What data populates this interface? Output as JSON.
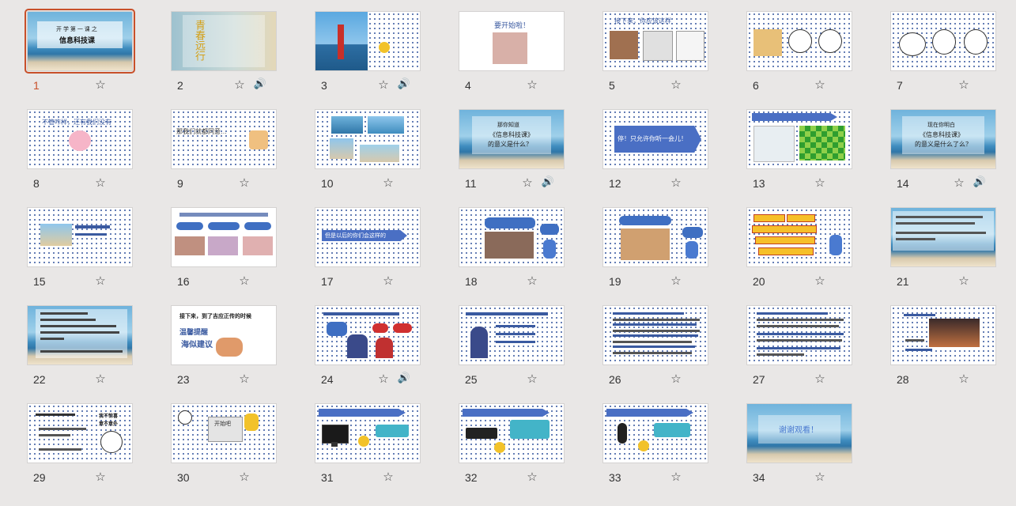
{
  "slides": [
    {
      "n": "1",
      "audio": false,
      "title_line1": "开 学 第 一 课 之",
      "title_line2": "信息科技课"
    },
    {
      "n": "2",
      "audio": true,
      "title": "青春远行"
    },
    {
      "n": "3",
      "audio": true
    },
    {
      "n": "4",
      "audio": false,
      "title": "要开始啦！"
    },
    {
      "n": "5",
      "audio": false,
      "title": "接下来，你应该这样"
    },
    {
      "n": "6",
      "audio": false
    },
    {
      "n": "7",
      "audio": false
    },
    {
      "n": "8",
      "audio": false,
      "title": "不管咋样，还有我们没有"
    },
    {
      "n": "9",
      "audio": false,
      "title": "那我们就都同意…"
    },
    {
      "n": "10",
      "audio": false
    },
    {
      "n": "11",
      "audio": true,
      "line1": "那你知道",
      "line2": "《信息科技课》",
      "line3": "的意义是什么？"
    },
    {
      "n": "12",
      "audio": false,
      "title": "停！只允许你听一会儿！"
    },
    {
      "n": "13",
      "audio": false
    },
    {
      "n": "14",
      "audio": true,
      "line1": "现在你明白",
      "line2": "《信息科技课》",
      "line3": "的意义是什么了么？"
    },
    {
      "n": "15",
      "audio": false
    },
    {
      "n": "16",
      "audio": false
    },
    {
      "n": "17",
      "audio": false,
      "title": "但是以后的你们会这样的"
    },
    {
      "n": "18",
      "audio": false
    },
    {
      "n": "19",
      "audio": false
    },
    {
      "n": "20",
      "audio": false
    },
    {
      "n": "21",
      "audio": false
    },
    {
      "n": "22",
      "audio": false
    },
    {
      "n": "23",
      "audio": false,
      "line1": "接下来，到了吉应正传的时候",
      "line2": "温馨提醒",
      "line3": "海似建议"
    },
    {
      "n": "24",
      "audio": true
    },
    {
      "n": "25",
      "audio": false
    },
    {
      "n": "26",
      "audio": false
    },
    {
      "n": "27",
      "audio": false
    },
    {
      "n": "28",
      "audio": false
    },
    {
      "n": "29",
      "audio": false,
      "side": "我不惊喜",
      "side2": "意不意外"
    },
    {
      "n": "30",
      "audio": false,
      "title": "开始吧"
    },
    {
      "n": "31",
      "audio": false
    },
    {
      "n": "32",
      "audio": false
    },
    {
      "n": "33",
      "audio": false
    },
    {
      "n": "34",
      "audio": false,
      "title": "谢谢观看！"
    }
  ],
  "icons": {
    "star": "☆",
    "audio": "🔊"
  },
  "colors": {
    "selected": "#c8502a",
    "dots": "#3a5aa0",
    "accent": "#4a6fc4"
  }
}
